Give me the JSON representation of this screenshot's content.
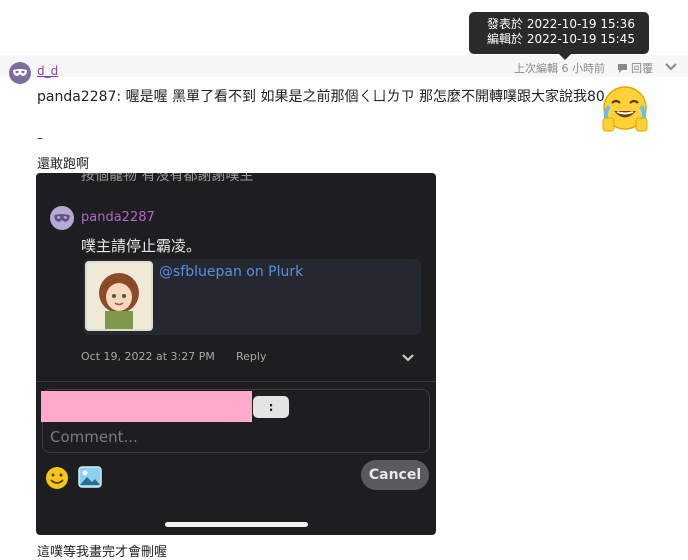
{
  "tooltip": {
    "posted": "發表於 2022-10-19 15:36",
    "edited": "編輯於 2022-10-19 15:45"
  },
  "post": {
    "username": "d_d",
    "edited_ago": "上次編輯 6 小時前",
    "reply_label": "回覆",
    "text": "panda2287: 喔是喔 黑單了看不到 如果是之前那個ㄑㄩㄌㄗ 那怎麼不開轉噗跟大家說我80",
    "emoji_icon": "crying-laughing-emoji",
    "dash": "–",
    "line2": "還敢跑啊",
    "bottom_text": "這噗等我畫完才會刪喔"
  },
  "screenshot": {
    "cut_text": "按個寵物 有沒有都謝謝噗主",
    "username": "panda2287",
    "text": "噗主請停止霸凌。",
    "link_card": "@sfbluepan on Plurk",
    "date": "Oct 19, 2022 at 3:27 PM",
    "reply": "Reply",
    "small_button": ":",
    "comment_placeholder": "Comment...",
    "cancel": "Cancel"
  },
  "colors": {
    "username": "#8a3fb0",
    "redaction": "#ffaacc",
    "link": "#5b8ee0"
  }
}
